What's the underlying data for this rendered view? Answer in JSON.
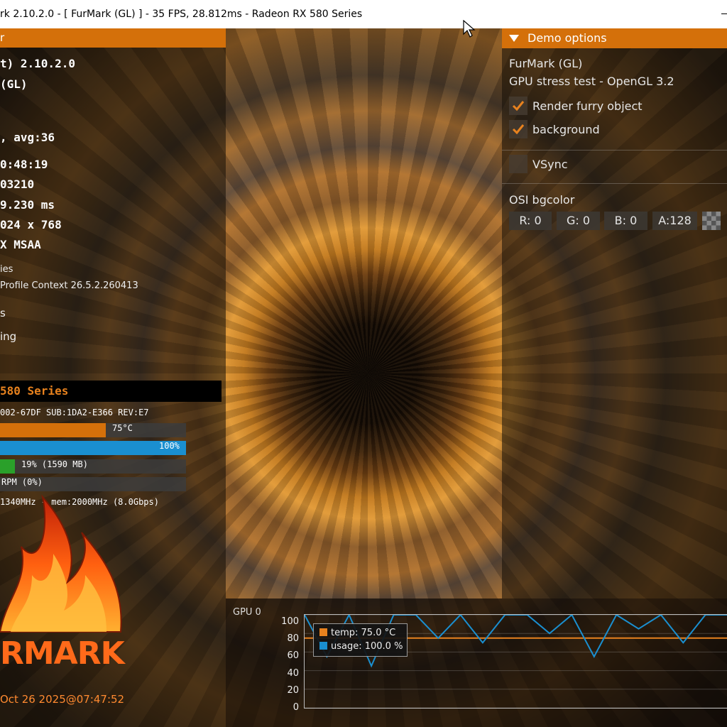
{
  "window": {
    "title": "rk 2.10.2.0 - [ FurMark (GL) ] - 35 FPS, 28.812ms - Radeon RX 580 Series"
  },
  "left_panel": {
    "header": "r",
    "lines": [
      "t) 2.10.2.0",
      "(GL)",
      ", avg:36",
      "0:48:19",
      "03210",
      "9.230 ms",
      "024 x 768",
      "X MSAA"
    ],
    "info_lines": [
      "ies",
      "Profile Context 26.5.2.260413",
      "s",
      "ing"
    ],
    "gpu": {
      "name": "580 Series",
      "device": "002-67DF SUB:1DA2-E366 REV:E7",
      "temp_label": "75°C",
      "temp_fraction": 0.57,
      "usage_label": "100%",
      "usage_fraction": 1.0,
      "mem_label": "19% (1590 MB)",
      "mem_fraction": 0.08,
      "fan_label": "RPM (0%)",
      "fan_fraction": 0.0,
      "clocks": "1340MHz - mem:2000MHz (8.0Gbps)"
    },
    "logo": {
      "text": "RMARK",
      "date": "Oct 26 2025@07:47:52"
    },
    "colors": {
      "accent": "#d4700a",
      "usage": "#1a8fd0",
      "mem": "#2aa02a"
    }
  },
  "demo_options": {
    "header": "Demo options",
    "title": "FurMark (GL)",
    "subtitle": "GPU stress test - OpenGL 3.2",
    "render_furry_label": "Render furry object",
    "render_furry_checked": true,
    "background_label": "background",
    "background_checked": true,
    "vsync_label": "VSync",
    "vsync_checked": false,
    "osi_label": "OSI bgcolor",
    "r": "R: 0",
    "g": "G: 0",
    "b": "B: 0",
    "a": "A:128"
  },
  "graph": {
    "label": "GPU 0",
    "yticks": [
      "100",
      "80",
      "60",
      "40",
      "20",
      "0"
    ],
    "legend_temp": "temp: 75.0 °C",
    "legend_usage": "usage: 100.0 %",
    "colors": {
      "temp": "#e8821e",
      "usage": "#1a8fd0"
    }
  },
  "chart_data": {
    "type": "line",
    "ylim": [
      0,
      100
    ],
    "series": [
      {
        "name": "temp: 75.0 °C",
        "values": [
          75,
          75,
          75,
          75,
          75,
          75,
          75,
          75,
          75,
          75,
          75,
          75,
          75,
          75,
          75,
          75,
          75,
          75,
          75,
          75
        ]
      },
      {
        "name": "usage: 100.0 %",
        "values": [
          100,
          55,
          100,
          45,
          100,
          100,
          75,
          100,
          70,
          100,
          100,
          80,
          100,
          55,
          100,
          85,
          100,
          70,
          100,
          100
        ]
      }
    ]
  }
}
